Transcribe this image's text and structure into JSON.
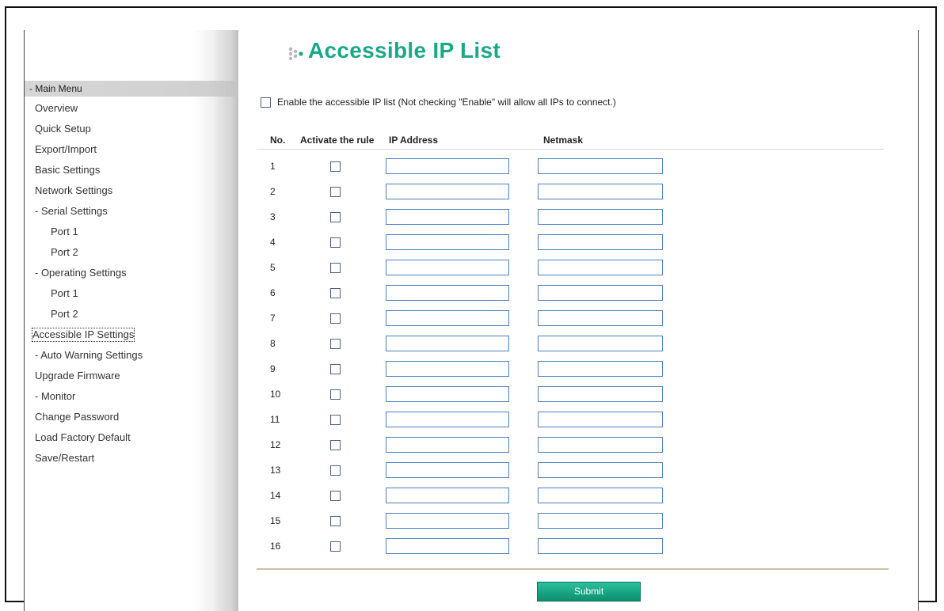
{
  "page": {
    "title": "Accessible IP List"
  },
  "sidebar": {
    "header": "- Main Menu",
    "items": [
      "Overview",
      "Quick Setup",
      "Export/Import",
      "Basic Settings",
      "Network Settings",
      "- Serial Settings",
      "Port 1",
      "Port 2",
      "- Operating Settings",
      "Port 1",
      "Port 2",
      "Accessible IP Settings",
      "- Auto Warning Settings",
      "Upgrade Firmware",
      "- Monitor",
      "Change Password",
      "Load Factory Default",
      "Save/Restart"
    ],
    "selected": "Accessible IP Settings"
  },
  "enable": {
    "label": "Enable the accessible IP list (Not checking \"Enable\" will allow all IPs to connect.)",
    "checked": false
  },
  "table": {
    "headers": {
      "no": "No.",
      "activate": "Activate the rule",
      "ip": "IP Address",
      "netmask": "Netmask"
    },
    "rows": [
      {
        "no": "1",
        "active": false,
        "ip": "",
        "netmask": ""
      },
      {
        "no": "2",
        "active": false,
        "ip": "",
        "netmask": ""
      },
      {
        "no": "3",
        "active": false,
        "ip": "",
        "netmask": ""
      },
      {
        "no": "4",
        "active": false,
        "ip": "",
        "netmask": ""
      },
      {
        "no": "5",
        "active": false,
        "ip": "",
        "netmask": ""
      },
      {
        "no": "6",
        "active": false,
        "ip": "",
        "netmask": ""
      },
      {
        "no": "7",
        "active": false,
        "ip": "",
        "netmask": ""
      },
      {
        "no": "8",
        "active": false,
        "ip": "",
        "netmask": ""
      },
      {
        "no": "9",
        "active": false,
        "ip": "",
        "netmask": ""
      },
      {
        "no": "10",
        "active": false,
        "ip": "",
        "netmask": ""
      },
      {
        "no": "11",
        "active": false,
        "ip": "",
        "netmask": ""
      },
      {
        "no": "12",
        "active": false,
        "ip": "",
        "netmask": ""
      },
      {
        "no": "13",
        "active": false,
        "ip": "",
        "netmask": ""
      },
      {
        "no": "14",
        "active": false,
        "ip": "",
        "netmask": ""
      },
      {
        "no": "15",
        "active": false,
        "ip": "",
        "netmask": ""
      },
      {
        "no": "16",
        "active": false,
        "ip": "",
        "netmask": ""
      }
    ]
  },
  "submit": {
    "label": "Submit"
  },
  "colors": {
    "accent": "#1aa889",
    "button": "#18a482",
    "input_border": "#4a7fc0"
  },
  "icons": {
    "title": "dots-bullet-icon"
  }
}
